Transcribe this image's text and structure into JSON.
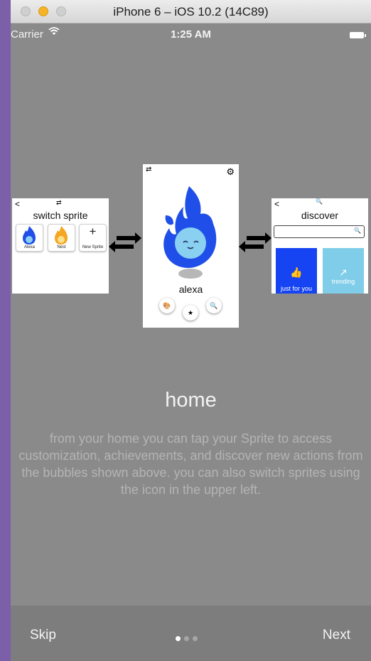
{
  "window": {
    "title": "iPhone 6 – iOS 10.2 (14C89)"
  },
  "status": {
    "carrier": "Carrier",
    "time": "1:25 AM"
  },
  "screens": {
    "left": {
      "title": "switch sprite",
      "cards": [
        {
          "label": "Alexa",
          "color": "#1f4fe8"
        },
        {
          "label": "Nest",
          "color": "#f5a623"
        },
        {
          "label": "New Sprite"
        }
      ]
    },
    "center": {
      "sprite_name": "alexa",
      "sprite_color": "#1f4fe8"
    },
    "right": {
      "title": "discover",
      "tiles": [
        "just for you",
        "trending"
      ]
    }
  },
  "content": {
    "heading": "home",
    "description": "from your home you can tap your Sprite to access customization, achievements, and discover new actions from the bubbles shown above. you can also switch sprites using the icon in the upper left."
  },
  "footer": {
    "skip": "Skip",
    "next": "Next",
    "page_count": 3,
    "current_page": 1
  },
  "icons": [
    "wifi-icon",
    "battery-icon",
    "gear-icon",
    "switch-arrows-icon",
    "search-icon",
    "thumbs-up-icon",
    "trending-icon",
    "palette-icon",
    "achievement-icon",
    "back-chevron-icon"
  ]
}
